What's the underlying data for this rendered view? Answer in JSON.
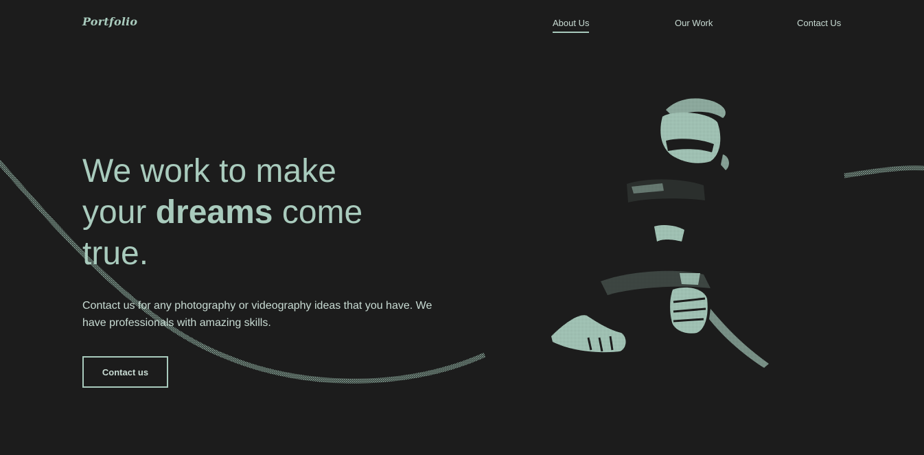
{
  "brand": {
    "logo_text": "Portfolio"
  },
  "nav": {
    "items": [
      {
        "label": "About Us",
        "active": true
      },
      {
        "label": "Our Work",
        "active": false
      },
      {
        "label": "Contact Us",
        "active": false
      }
    ]
  },
  "hero": {
    "headline_part1": "We work to make your ",
    "headline_emphasis": "dreams",
    "headline_part2": " come true.",
    "subtext": "Contact us for any photography or videography ideas that you have. We have professionals with amazing skills.",
    "cta_label": "Contact us"
  },
  "colors": {
    "background": "#1c1c1c",
    "accent": "#a9cbbd",
    "text_light": "#c9dcd4"
  },
  "icons": {
    "photo": "photographer-with-camera-image"
  }
}
